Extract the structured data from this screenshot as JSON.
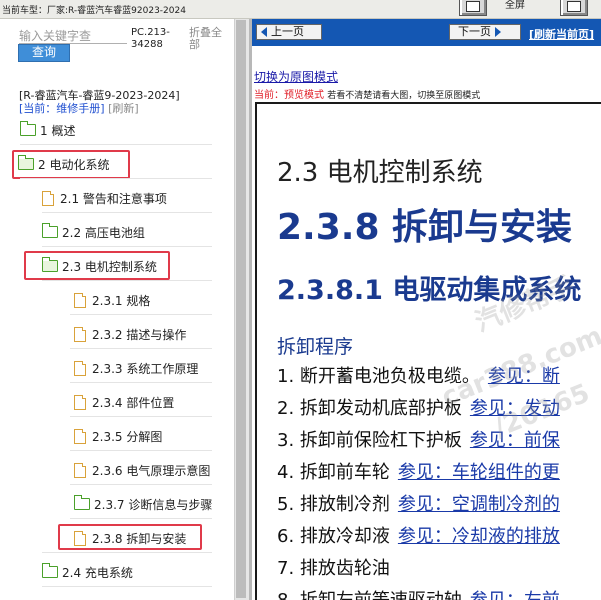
{
  "top": {
    "car_model": "当前车型：厂家:R-睿蓝汽车睿蓝92023-2024",
    "right_label": "全屏"
  },
  "sidebar": {
    "search_placeholder": "输入关键字查",
    "search_button": "查询",
    "pc_code": "PC.213-34288",
    "collapse_all": "折叠全部",
    "manual_title": "[R-睿蓝汽车-睿蓝9-2023-2024]",
    "current_label": "[当前：维修手册]",
    "refresh_label": "[刷新]",
    "tree": [
      {
        "label": "1 概述",
        "type": "folder"
      },
      {
        "label": "2 电动化系统",
        "type": "folder-open"
      },
      {
        "label": "2.1 警告和注意事项",
        "type": "doc"
      },
      {
        "label": "2.2 高压电池组",
        "type": "folder"
      },
      {
        "label": "2.3 电机控制系统",
        "type": "folder-open"
      },
      {
        "label": "2.3.1 规格",
        "type": "doc"
      },
      {
        "label": "2.3.2 描述与操作",
        "type": "doc"
      },
      {
        "label": "2.3.3 系统工作原理",
        "type": "doc"
      },
      {
        "label": "2.3.4 部件位置",
        "type": "doc"
      },
      {
        "label": "2.3.5 分解图",
        "type": "doc"
      },
      {
        "label": "2.3.6 电气原理示意图",
        "type": "doc"
      },
      {
        "label": "2.3.7 诊断信息与步骤",
        "type": "folder"
      },
      {
        "label": "2.3.8 拆卸与安装",
        "type": "doc"
      },
      {
        "label": "2.4 充电系统",
        "type": "folder"
      }
    ]
  },
  "nav": {
    "prev": "上一页",
    "next": "下一页",
    "refresh": "[刷新当前页]"
  },
  "content": {
    "switch_link": "切换为原图模式",
    "mode_label": "当前：预览模式",
    "mode_hint": "若看不清楚请看大图，切换至原图模式",
    "chapter": "2.3 电机控制系统",
    "section": "2.3.8 拆卸与安装",
    "subsection": "2.3.8.1 电驱动集成系统",
    "procedure": "拆卸程序",
    "steps": [
      {
        "text": "1. 断开蓄电池负极电缆。",
        "ref": "参见：断"
      },
      {
        "text": "2. 拆卸发动机底部护板",
        "ref": "参见：发动"
      },
      {
        "text": "3. 拆卸前保险杠下护板",
        "ref": "参见：前保"
      },
      {
        "text": "4. 拆卸前车轮",
        "ref": "参见：车轮组件的更"
      },
      {
        "text": "5. 排放制冷剂",
        "ref": "参见：空调制冷剂的"
      },
      {
        "text": "6. 排放冷却液",
        "ref": "参见：冷却液的排放"
      },
      {
        "text": "7. 排放齿轮油",
        "ref": ""
      },
      {
        "text": "8. 拆卸左前等速驱动轴",
        "ref": "参见：左前"
      }
    ],
    "watermarks": [
      "汽修帮手",
      "car388.com",
      "/20165"
    ]
  },
  "colors": {
    "nav_blue": "#1457b3",
    "search_blue": "#3f8ed8",
    "heading_blue": "#1a3a8f",
    "highlight_red": "#e03a4a"
  }
}
